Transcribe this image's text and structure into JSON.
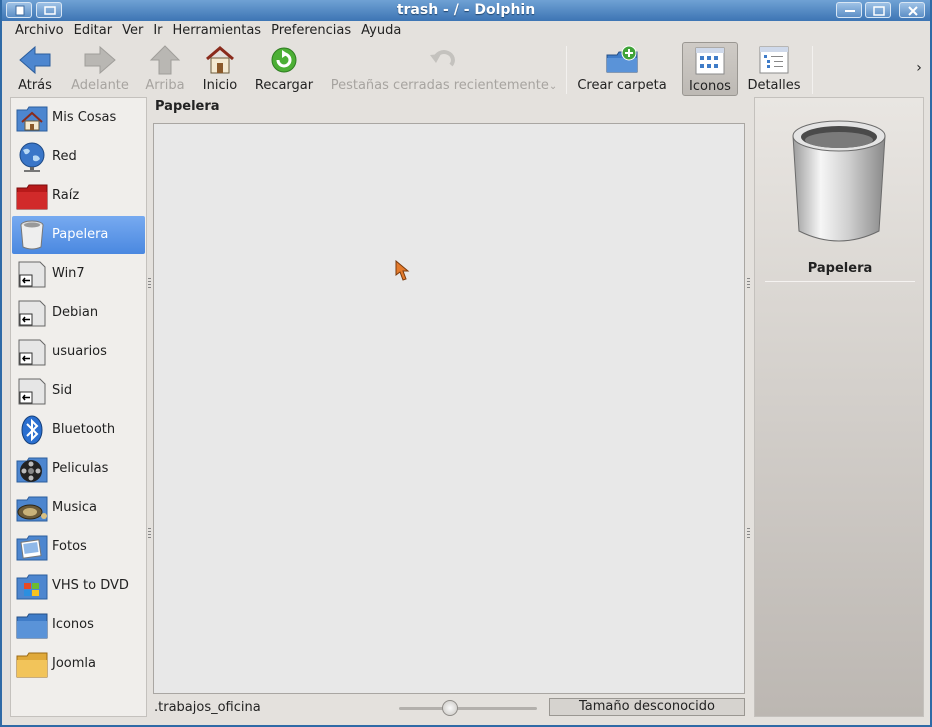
{
  "window": {
    "title": "trash - / - Dolphin"
  },
  "menu": [
    "Archivo",
    "Editar",
    "Ver",
    "Ir",
    "Herramientas",
    "Preferencias",
    "Ayuda"
  ],
  "toolbar": {
    "back": "Atrás",
    "forward": "Adelante",
    "up": "Arriba",
    "home": "Inicio",
    "reload": "Recargar",
    "closed_tabs": "Pestañas cerradas recientemente",
    "new_folder": "Crear carpeta",
    "icons": "Iconos",
    "details": "Detalles",
    "overflow": "›"
  },
  "places": [
    {
      "label": "Mis Cosas",
      "icon": "home-folder-icon"
    },
    {
      "label": "Red",
      "icon": "network-globe-icon"
    },
    {
      "label": "Raíz",
      "icon": "root-folder-icon"
    },
    {
      "label": "Papelera",
      "icon": "trash-icon",
      "selected": true
    },
    {
      "label": "Win7",
      "icon": "drive-icon"
    },
    {
      "label": "Debian",
      "icon": "drive-icon"
    },
    {
      "label": "usuarios",
      "icon": "drive-icon"
    },
    {
      "label": "Sid",
      "icon": "drive-icon"
    },
    {
      "label": "Bluetooth",
      "icon": "bluetooth-icon"
    },
    {
      "label": "Peliculas",
      "icon": "film-folder-icon"
    },
    {
      "label": "Musica",
      "icon": "music-folder-icon"
    },
    {
      "label": "Fotos",
      "icon": "photos-folder-icon"
    },
    {
      "label": "VHS to DVD",
      "icon": "windows-folder-icon"
    },
    {
      "label": "Iconos",
      "icon": "blue-folder-icon"
    },
    {
      "label": "Joomla",
      "icon": "yellow-folder-icon"
    }
  ],
  "location": {
    "breadcrumb": "Papelera"
  },
  "status": {
    "text": ".trabajos_oficina",
    "size": "Tamaño desconocido"
  },
  "info_panel": {
    "name": "Papelera"
  },
  "colors": {
    "titlebar": "#3d75b4",
    "selection": "#4a88e0"
  }
}
